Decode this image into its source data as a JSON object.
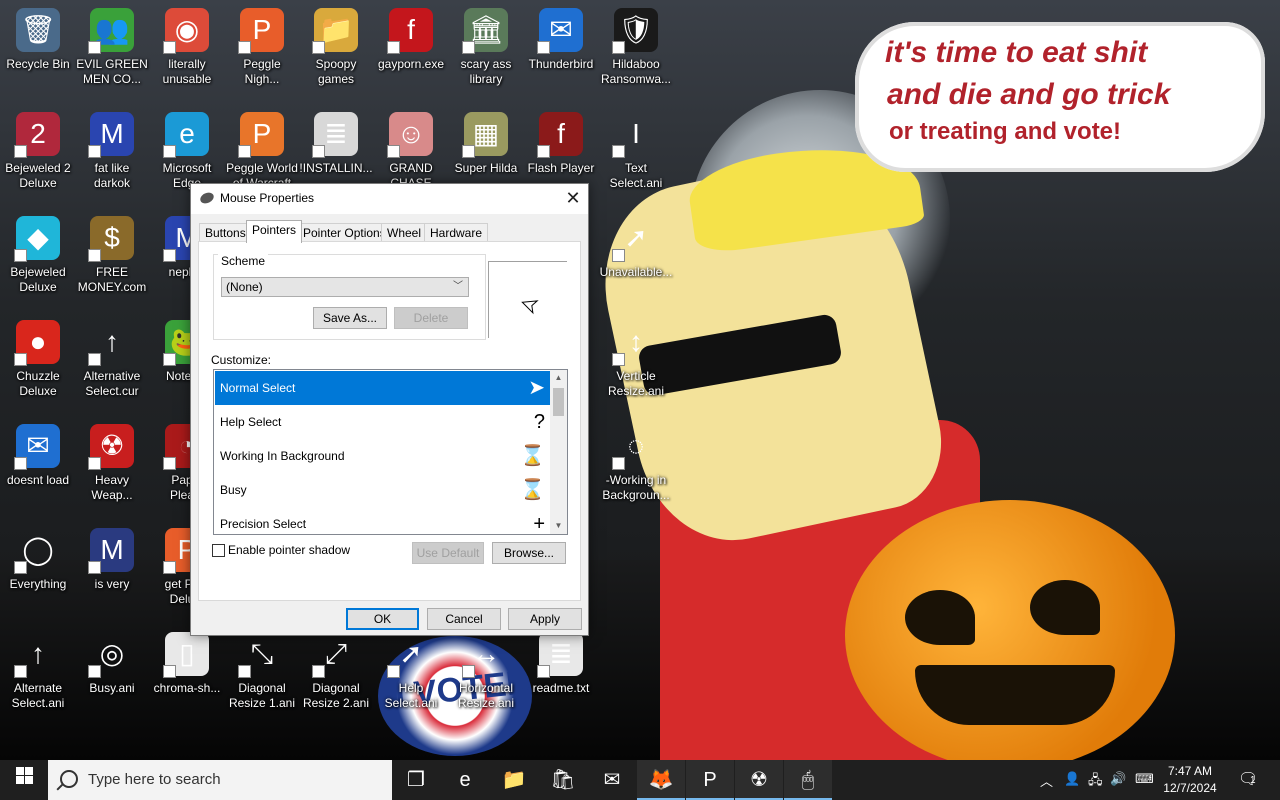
{
  "wallpaper": {
    "banner_lines": [
      "it's time to eat shit",
      "and die and go trick",
      "or treating and vote!"
    ],
    "voted_text": "I VOTED"
  },
  "desktop_icons": [
    {
      "label": "Recycle Bin",
      "icon": "recycle-bin-icon",
      "glyph": "🗑",
      "color": "#4a6a8a",
      "col": 0,
      "row": 0,
      "shortcut": false
    },
    {
      "label": "EVIL GREEN\nMEN CO...",
      "icon": "green-men-icon",
      "glyph": "👥",
      "color": "#3aa13a",
      "col": 1,
      "row": 0
    },
    {
      "label": "literally\nunusable",
      "icon": "chrome-icon",
      "glyph": "◉",
      "color": "#dd4b39",
      "col": 2,
      "row": 0
    },
    {
      "label": "Peggle\nNigh...",
      "icon": "peggle-icon",
      "glyph": "P",
      "color": "#e85d2a",
      "col": 3,
      "row": 0
    },
    {
      "label": "Spoopy\ngames",
      "icon": "folder-icon",
      "glyph": "📁",
      "color": "#d9a93c",
      "col": 4,
      "row": 0
    },
    {
      "label": "gayporn.exe",
      "icon": "flash-icon",
      "glyph": "f",
      "color": "#c4161c",
      "col": 5,
      "row": 0
    },
    {
      "label": "scary ass\nlibrary",
      "icon": "library-icon",
      "glyph": "🏛",
      "color": "#5a7a5a",
      "col": 6,
      "row": 0
    },
    {
      "label": "Thunderbird",
      "icon": "thunderbird-icon",
      "glyph": "✉",
      "color": "#1f6fd1",
      "col": 7,
      "row": 0
    },
    {
      "label": "Hildaboo\nRansomwa...",
      "icon": "shield-icon",
      "glyph": "🛡",
      "color": "#1a1a1a",
      "col": 8,
      "row": 0
    },
    {
      "label": "Bejeweled 2\nDeluxe",
      "icon": "bejeweled2-icon",
      "glyph": "2",
      "color": "#b0283c",
      "col": 0,
      "row": 1
    },
    {
      "label": "fat like\ndarkok",
      "icon": "mpl-icon",
      "glyph": "M",
      "color": "#2a45b0",
      "col": 1,
      "row": 1
    },
    {
      "label": "Microsoft\nEdge",
      "icon": "edge-icon",
      "glyph": "e",
      "color": "#1b9ad6",
      "col": 2,
      "row": 1
    },
    {
      "label": "Peggle World\nof Warcraft",
      "icon": "peggle-wow-icon",
      "glyph": "P",
      "color": "#e8752a",
      "col": 3,
      "row": 1
    },
    {
      "label": "!INSTALLIN...",
      "icon": "text-file-icon",
      "glyph": "≣",
      "color": "#d8d8d8",
      "col": 4,
      "row": 1
    },
    {
      "label": "GRAND\nCHASE",
      "icon": "grand-chase-icon",
      "glyph": "☺",
      "color": "#d88a8a",
      "col": 5,
      "row": 1
    },
    {
      "label": "Super Hilda",
      "icon": "super-hilda-icon",
      "glyph": "▦",
      "color": "#9a9a60",
      "col": 6,
      "row": 1
    },
    {
      "label": "Flash Player",
      "icon": "flash-player-icon",
      "glyph": "f",
      "color": "#8b1a1a",
      "col": 7,
      "row": 1
    },
    {
      "label": "Text\nSelect.ani",
      "icon": "text-select-cursor-icon",
      "glyph": "I",
      "color": "transparent",
      "col": 8,
      "row": 1
    },
    {
      "label": "Bejeweled\nDeluxe",
      "icon": "diamond-icon",
      "glyph": "◆",
      "color": "#1fb6d9",
      "col": 0,
      "row": 2
    },
    {
      "label": "FREE\nMONEY.com",
      "icon": "money-bag-icon",
      "glyph": "$",
      "color": "#8a6a2a",
      "col": 1,
      "row": 2
    },
    {
      "label": "neph...",
      "icon": "mpl-blue-icon",
      "glyph": "M",
      "color": "#2a45b0",
      "col": 2,
      "row": 2
    },
    {
      "label": "Unavailable...",
      "icon": "unavailable-cursor-icon",
      "glyph": "➚",
      "color": "transparent",
      "col": 8,
      "row": 2
    },
    {
      "label": "Chuzzle\nDeluxe",
      "icon": "chuzzle-icon",
      "glyph": "●",
      "color": "#d9261c",
      "col": 0,
      "row": 3
    },
    {
      "label": "Alternative\nSelect.cur",
      "icon": "arrow-up-cursor-icon",
      "glyph": "↑",
      "color": "transparent",
      "col": 1,
      "row": 3
    },
    {
      "label": "Notep...",
      "icon": "notepad-icon",
      "glyph": "🐸",
      "color": "#3aa13a",
      "col": 2,
      "row": 3
    },
    {
      "label": "Verticle\nResize.ani",
      "icon": "vertical-resize-cursor-icon",
      "glyph": "↕",
      "color": "transparent",
      "col": 8,
      "row": 3
    },
    {
      "label": "doesnt load",
      "icon": "thunderbird-blue-icon",
      "glyph": "✉",
      "color": "#1f6fd1",
      "col": 0,
      "row": 4
    },
    {
      "label": "Heavy\nWeap...",
      "icon": "radiation-icon",
      "glyph": "☢",
      "color": "#c81e1e",
      "col": 1,
      "row": 4
    },
    {
      "label": "Pap...\nPlea...",
      "icon": "paper-icon",
      "glyph": "◔",
      "color": "#aa1a1a",
      "col": 2,
      "row": 4
    },
    {
      "label": "-Working in\nBackgroun...",
      "icon": "working-cursor-icon",
      "glyph": "◌",
      "color": "transparent",
      "col": 8,
      "row": 4
    },
    {
      "label": "Everything",
      "icon": "everything-search-icon",
      "glyph": "◯",
      "color": "transparent",
      "col": 0,
      "row": 5
    },
    {
      "label": "is very",
      "icon": "mpl-shield-icon",
      "glyph": "M",
      "color": "#2a3a80",
      "col": 1,
      "row": 5
    },
    {
      "label": "get Pe...\nDelu...",
      "icon": "peggle-deluxe-icon",
      "glyph": "P",
      "color": "#e85d2a",
      "col": 2,
      "row": 5
    },
    {
      "label": "Alternate\nSelect.ani",
      "icon": "alternate-select-cursor-icon",
      "glyph": "↑",
      "color": "transparent",
      "col": 0,
      "row": 6
    },
    {
      "label": "Busy.ani",
      "icon": "busy-ring-icon",
      "glyph": "◎",
      "color": "transparent",
      "col": 1,
      "row": 6
    },
    {
      "label": "chroma-sh...",
      "icon": "blank-file-icon",
      "glyph": "▯",
      "color": "#e8e8e8",
      "col": 2,
      "row": 6
    },
    {
      "label": "Diagonal\nResize 1.ani",
      "icon": "diagonal-resize1-cursor-icon",
      "glyph": "⤡",
      "color": "transparent",
      "col": 3,
      "row": 6
    },
    {
      "label": "Diagonal\nResize 2.ani",
      "icon": "diagonal-resize2-cursor-icon",
      "glyph": "⤢",
      "color": "transparent",
      "col": 4,
      "row": 6
    },
    {
      "label": "Help\nSelect.ani",
      "icon": "help-select-cursor-icon",
      "glyph": "➚",
      "color": "transparent",
      "col": 5,
      "row": 6
    },
    {
      "label": "Horizontal\nResize.ani",
      "icon": "horizontal-resize-cursor-icon",
      "glyph": "↔",
      "color": "transparent",
      "col": 6,
      "row": 6
    },
    {
      "label": "readme.txt",
      "icon": "readme-file-icon",
      "glyph": "≣",
      "color": "#e8e8e8",
      "col": 7,
      "row": 6
    }
  ],
  "dialog": {
    "title": "Mouse Properties",
    "tabs": [
      "Buttons",
      "Pointers",
      "Pointer Options",
      "Wheel",
      "Hardware"
    ],
    "active_tab": "Pointers",
    "scheme_label": "Scheme",
    "scheme_value": "(None)",
    "save_as": "Save As...",
    "delete": "Delete",
    "customize_label": "Customize:",
    "pointers": [
      {
        "name": "Normal Select",
        "cursor": "➤",
        "selected": true
      },
      {
        "name": "Help Select",
        "cursor": "?"
      },
      {
        "name": "Working In Background",
        "cursor": "⌛"
      },
      {
        "name": "Busy",
        "cursor": "⌛"
      },
      {
        "name": "Precision Select",
        "cursor": "+"
      }
    ],
    "enable_shadow": "Enable pointer shadow",
    "shadow_checked": false,
    "use_default": "Use Default",
    "browse": "Browse...",
    "ok": "OK",
    "cancel": "Cancel",
    "apply": "Apply"
  },
  "taskbar": {
    "search_placeholder": "Type here to search",
    "time": "7:47 AM",
    "date": "12/7/2024",
    "notification_count": "1",
    "apps": [
      {
        "icon": "task-view-icon",
        "glyph": "❐",
        "running": false
      },
      {
        "icon": "edge-taskbar-icon",
        "glyph": "e",
        "running": false
      },
      {
        "icon": "file-explorer-icon",
        "glyph": "📁",
        "running": false
      },
      {
        "icon": "store-icon",
        "glyph": "🛍",
        "running": false
      },
      {
        "icon": "mail-icon",
        "glyph": "✉",
        "running": false
      },
      {
        "icon": "firefox-icon",
        "glyph": "🦊",
        "running": true
      },
      {
        "icon": "peggle-taskbar-icon",
        "glyph": "P",
        "running": true
      },
      {
        "icon": "radiation-taskbar-icon",
        "glyph": "☢",
        "running": true
      },
      {
        "icon": "mouse-taskbar-icon",
        "glyph": "🖱",
        "running": true
      }
    ]
  }
}
